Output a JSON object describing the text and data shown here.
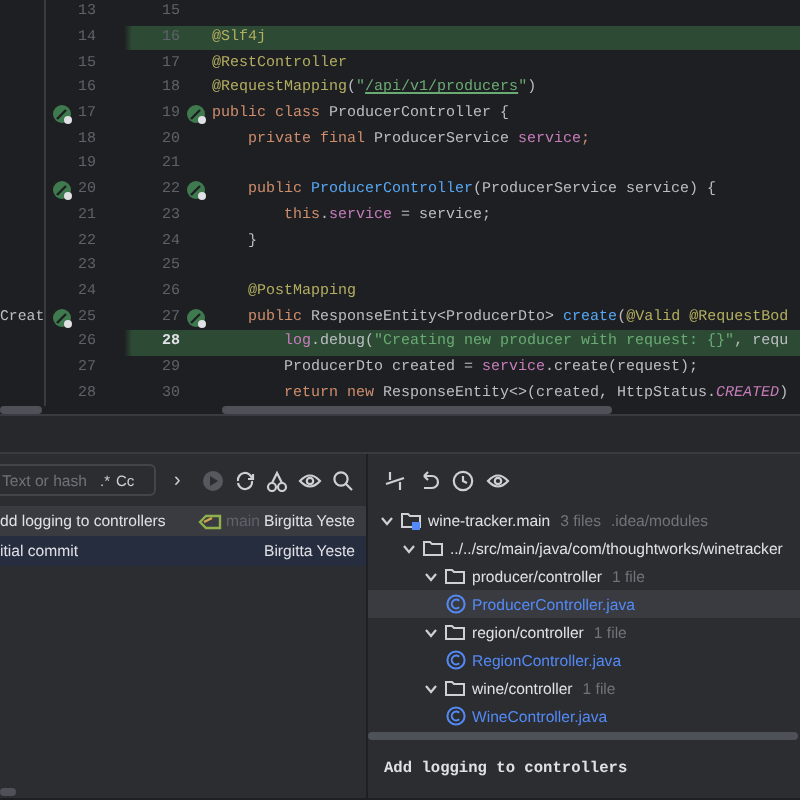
{
  "editor": {
    "lines": [
      {
        "left_number": "13",
        "right_number": "15",
        "left_icon": false,
        "right_icon": false,
        "changed": false,
        "current": false
      },
      {
        "left_number": "14",
        "right_number": "16",
        "left_icon": false,
        "right_icon": false,
        "changed": true,
        "current": false,
        "tokens": [
          {
            "kind": "annotation",
            "text": "@Slf4j"
          }
        ]
      },
      {
        "left_number": "15",
        "right_number": "17",
        "left_icon": false,
        "right_icon": false,
        "changed": false,
        "current": false,
        "tokens": [
          {
            "kind": "annotation",
            "text": "@RestController"
          }
        ]
      },
      {
        "left_number": "16",
        "right_number": "18",
        "left_icon": false,
        "right_icon": false,
        "changed": false,
        "current": false,
        "tokens": [
          {
            "kind": "annotation",
            "text": "@RequestMapping"
          },
          {
            "kind": "plain",
            "text": "("
          },
          {
            "kind": "string",
            "text": "\""
          },
          {
            "kind": "link",
            "text": "/api/v1/producers"
          },
          {
            "kind": "string",
            "text": "\""
          },
          {
            "kind": "plain",
            "text": ")"
          }
        ]
      },
      {
        "left_number": "17",
        "right_number": "19",
        "left_icon": true,
        "right_icon": true,
        "changed": false,
        "current": false,
        "tokens": [
          {
            "kind": "keyword",
            "text": "public class "
          },
          {
            "kind": "plain",
            "text": "ProducerController {"
          }
        ]
      },
      {
        "left_number": "18",
        "right_number": "20",
        "left_icon": false,
        "right_icon": false,
        "changed": false,
        "current": false,
        "tokens": [
          {
            "kind": "keyword",
            "text": "    private final "
          },
          {
            "kind": "plain",
            "text": "ProducerService "
          },
          {
            "kind": "field",
            "text": "service"
          },
          {
            "kind": "keyword",
            "text": ";"
          }
        ]
      },
      {
        "left_number": "19",
        "right_number": "21",
        "left_icon": false,
        "right_icon": false,
        "changed": false,
        "current": false
      },
      {
        "left_number": "20",
        "right_number": "22",
        "left_icon": true,
        "right_icon": true,
        "changed": false,
        "current": false,
        "tokens": [
          {
            "kind": "keyword",
            "text": "    public "
          },
          {
            "kind": "declaration",
            "text": "ProducerController"
          },
          {
            "kind": "plain",
            "text": "(ProducerService service) {"
          }
        ]
      },
      {
        "left_number": "21",
        "right_number": "23",
        "left_icon": false,
        "right_icon": false,
        "changed": false,
        "current": false,
        "tokens": [
          {
            "kind": "keyword",
            "text": "        this"
          },
          {
            "kind": "plain",
            "text": "."
          },
          {
            "kind": "field",
            "text": "service"
          },
          {
            "kind": "plain",
            "text": " = service;"
          }
        ]
      },
      {
        "left_number": "22",
        "right_number": "24",
        "left_icon": false,
        "right_icon": false,
        "changed": false,
        "current": false,
        "tokens": [
          {
            "kind": "plain",
            "text": "    }"
          }
        ]
      },
      {
        "left_number": "23",
        "right_number": "25",
        "left_icon": false,
        "right_icon": false,
        "changed": false,
        "current": false
      },
      {
        "left_number": "24",
        "right_number": "26",
        "left_icon": false,
        "right_icon": false,
        "changed": false,
        "current": false,
        "tokens": [
          {
            "kind": "annotation",
            "text": "    @PostMapping"
          }
        ]
      },
      {
        "left_number": "25",
        "right_number": "27",
        "left_icon": true,
        "right_icon": true,
        "changed": false,
        "current": false,
        "side_text": "Creat",
        "tokens": [
          {
            "kind": "keyword",
            "text": "    public "
          },
          {
            "kind": "plain",
            "text": "ResponseEntity<ProducerDto> "
          },
          {
            "kind": "declaration",
            "text": "create"
          },
          {
            "kind": "plain",
            "text": "("
          },
          {
            "kind": "annotation",
            "text": "@Valid @RequestBod"
          }
        ]
      },
      {
        "left_number": "26",
        "right_number": "28",
        "left_icon": false,
        "right_icon": false,
        "changed": true,
        "current": true,
        "tokens": [
          {
            "kind": "field",
            "text": "        log"
          },
          {
            "kind": "plain",
            "text": ".debug("
          },
          {
            "kind": "string",
            "text": "\"Creating new producer with request: {}\""
          },
          {
            "kind": "plain",
            "text": ", requ"
          }
        ]
      },
      {
        "left_number": "27",
        "right_number": "29",
        "left_icon": false,
        "right_icon": false,
        "changed": false,
        "current": false,
        "tokens": [
          {
            "kind": "plain",
            "text": "        ProducerDto created = "
          },
          {
            "kind": "field",
            "text": "service"
          },
          {
            "kind": "plain",
            "text": ".create(request);"
          }
        ]
      },
      {
        "left_number": "28",
        "right_number": "30",
        "left_icon": false,
        "right_icon": false,
        "changed": false,
        "current": false,
        "tokens": [
          {
            "kind": "keyword",
            "text": "        return new "
          },
          {
            "kind": "plain",
            "text": "ResponseEntity<>(created, HttpStatus."
          },
          {
            "kind": "constant",
            "text": "CREATED"
          },
          {
            "kind": "plain",
            "text": ")"
          }
        ]
      }
    ]
  },
  "git_log": {
    "search": {
      "placeholder": "Text or hash",
      "regex": ".*",
      "match_case": "Cc"
    },
    "branch_arrow": "›",
    "commits": [
      {
        "subject": "dd logging to controllers",
        "branch": "main",
        "author": "Birgitta Yeste",
        "selected": true
      },
      {
        "subject": "itial commit",
        "author": "Birgitta Yeste",
        "selected": false
      }
    ]
  },
  "changes": {
    "tree": [
      {
        "kind": "module",
        "label": "wine-tracker.main",
        "count": "3 files",
        "path": ".idea/modules",
        "expanded": true,
        "selected": false,
        "children": [
          {
            "kind": "folder",
            "label": "../../src/main/java/com/thoughtworks/winetracker",
            "expanded": true,
            "selected": false,
            "children": [
              {
                "kind": "folder",
                "label": "producer/controller",
                "count": "1 file",
                "expanded": true,
                "selected": false,
                "children": [
                  {
                    "kind": "class",
                    "label": "ProducerController.java",
                    "selected": true
                  }
                ]
              },
              {
                "kind": "folder",
                "label": "region/controller",
                "count": "1 file",
                "expanded": true,
                "selected": false,
                "children": [
                  {
                    "kind": "class",
                    "label": "RegionController.java",
                    "selected": false
                  }
                ]
              },
              {
                "kind": "folder",
                "label": "wine/controller",
                "count": "1 file",
                "expanded": true,
                "selected": false,
                "children": [
                  {
                    "kind": "class",
                    "label": "WineController.java",
                    "selected": false
                  }
                ]
              }
            ]
          }
        ]
      }
    ],
    "commit_message": "Add logging to controllers"
  }
}
